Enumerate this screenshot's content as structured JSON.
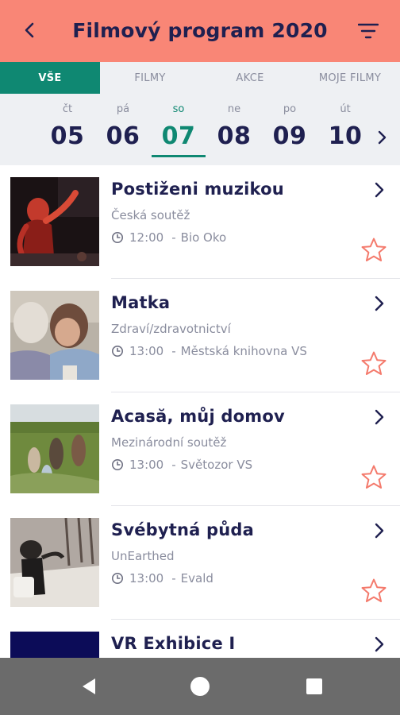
{
  "appbar": {
    "title": "Filmový program 2020",
    "back_icon": "arrow-back-icon",
    "filter_icon": "filter-icon"
  },
  "tabs": [
    {
      "label": "VŠE",
      "active": true
    },
    {
      "label": "FILMY",
      "active": false
    },
    {
      "label": "AKCE",
      "active": false
    },
    {
      "label": "MOJE FILMY",
      "active": false
    }
  ],
  "days": [
    {
      "name": "čt",
      "date": "05"
    },
    {
      "name": "pá",
      "date": "06"
    },
    {
      "name": "so",
      "date": "07",
      "active": true
    },
    {
      "name": "ne",
      "date": "08"
    },
    {
      "name": "po",
      "date": "09"
    },
    {
      "name": "út",
      "date": "10"
    }
  ],
  "events": [
    {
      "title": "Postiženi muzikou",
      "category": "Česká soutěž",
      "time": "12:00",
      "venue": "Bio Oko"
    },
    {
      "title": "Matka",
      "category": "Zdraví/zdravotnictví",
      "time": "13:00",
      "venue": "Městská knihovna VS"
    },
    {
      "title": "Acasă, můj domov",
      "category": "Mezinárodní soutěž",
      "time": "13:00",
      "venue": "Světozor VS"
    },
    {
      "title": "Svébytná půda",
      "category": "UnEarthed",
      "time": "13:00",
      "venue": "Evald"
    },
    {
      "title": "VR Exhibice I",
      "category": "",
      "time": "",
      "venue": ""
    }
  ],
  "colors": {
    "header": "#f98676",
    "accent": "#0f8872",
    "text": "#1f2050",
    "muted": "#8a8d9e",
    "star": "#f47a6c",
    "navbar": "#6b6b6b"
  },
  "navbar": {
    "back_icon": "nav-back-triangle-icon",
    "home_icon": "nav-home-circle-icon",
    "recents_icon": "nav-recents-square-icon"
  }
}
